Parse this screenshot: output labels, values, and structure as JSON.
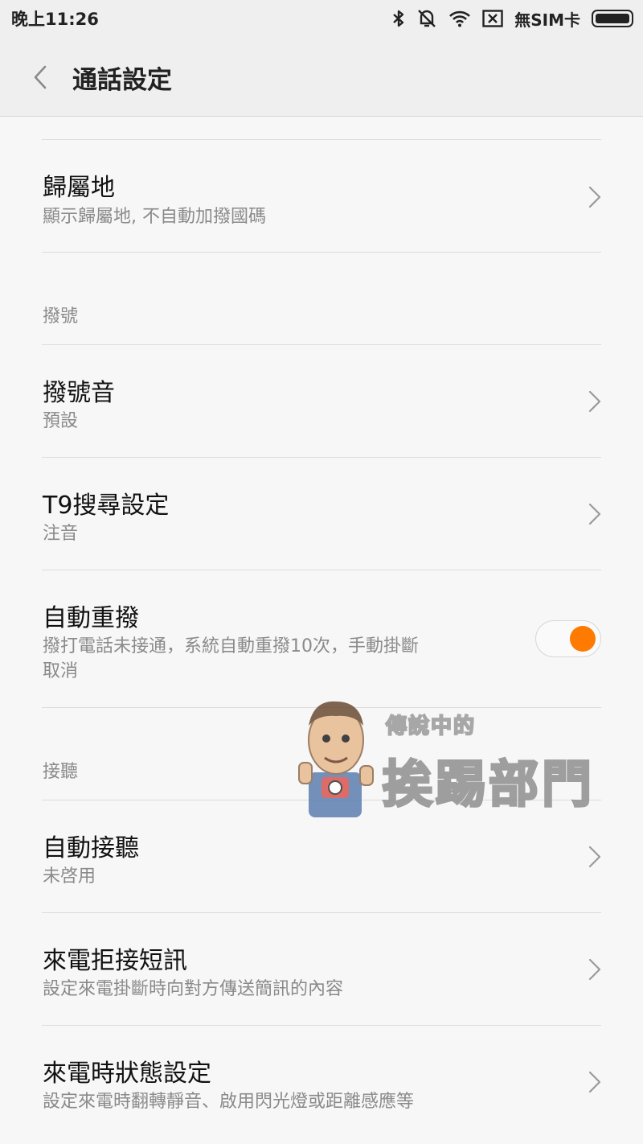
{
  "status_bar": {
    "time": "晚上11:26",
    "sim_text": "無SIM卡",
    "icons": [
      "bluetooth-icon",
      "vibrate-mute-icon",
      "wifi-icon",
      "no-sim-icon",
      "battery-icon"
    ]
  },
  "header": {
    "title": "通話設定",
    "back_icon": "chevron-left-icon"
  },
  "items": [
    {
      "title": "歸屬地",
      "subtitle": "顯示歸屬地, 不自動加撥國碼",
      "control": "chevron"
    },
    {
      "title": "撥號音",
      "subtitle": "預設",
      "control": "chevron"
    },
    {
      "title": "T9搜尋設定",
      "subtitle": "注音",
      "control": "chevron"
    },
    {
      "title": "自動重撥",
      "subtitle_line1": "撥打電話未接通，系統自動重撥10次，手動掛斷",
      "subtitle_line2": "取消",
      "control": "toggle",
      "enabled": true
    },
    {
      "title": "自動接聽",
      "subtitle": "未啓用",
      "control": "chevron"
    },
    {
      "title": "來電拒接短訊",
      "subtitle": "設定來電掛斷時向對方傳送簡訊的內容",
      "control": "chevron"
    },
    {
      "title": "來電時狀態設定",
      "subtitle": "設定來電時翻轉靜音、啟用閃光燈或距離感應等",
      "control": "chevron"
    }
  ],
  "sections": {
    "dial": "撥號",
    "answer": "接聽"
  },
  "watermark": {
    "line1": "傳說中的",
    "line2": "挨踢部門"
  },
  "colors": {
    "accent": "#ff7a00",
    "background": "#f7f7f7",
    "header": "#efefef",
    "subtitle": "#8a8a8a",
    "divider": "#dcdcdc"
  }
}
